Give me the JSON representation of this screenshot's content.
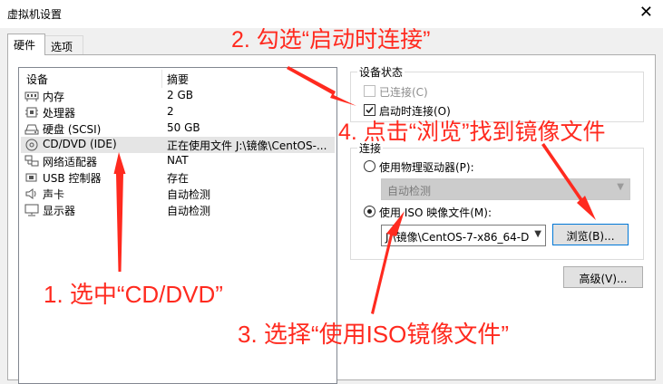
{
  "window": {
    "title": "虚拟机设置",
    "close_glyph": "✕"
  },
  "tabs": [
    {
      "label": "硬件",
      "active": true
    },
    {
      "label": "选项",
      "active": false
    }
  ],
  "device_list": {
    "headers": {
      "device": "设备",
      "summary": "摘要"
    },
    "rows": [
      {
        "icon": "memory-icon",
        "name": "内存",
        "summary": "2 GB"
      },
      {
        "icon": "cpu-icon",
        "name": "处理器",
        "summary": "2"
      },
      {
        "icon": "harddisk-icon",
        "name": "硬盘 (SCSI)",
        "summary": "50 GB"
      },
      {
        "icon": "cd-dvd-icon",
        "name": "CD/DVD (IDE)",
        "summary": "正在使用文件 J:\\镜像\\CentOS-...",
        "selected": true
      },
      {
        "icon": "network-icon",
        "name": "网络适配器",
        "summary": "NAT"
      },
      {
        "icon": "usb-icon",
        "name": "USB 控制器",
        "summary": "存在"
      },
      {
        "icon": "speaker-icon",
        "name": "声卡",
        "summary": "自动检测"
      },
      {
        "icon": "monitor-icon",
        "name": "显示器",
        "summary": "自动检测"
      }
    ]
  },
  "device_status": {
    "label": "设备状态",
    "connected": {
      "label": "已连接(C)",
      "checked": false,
      "disabled": true
    },
    "connect_at_power_on": {
      "label": "启动时连接(O)",
      "checked": true
    }
  },
  "connection": {
    "label": "连接",
    "physical_drive": {
      "label": "使用物理驱动器(P):",
      "selected": false
    },
    "drive_select": {
      "value": "自动检测"
    },
    "iso_image": {
      "label": "使用 ISO 映像文件(M):",
      "selected": true
    },
    "iso_path": {
      "value": "J:\\镜像\\CentOS-7-x86_64-D"
    },
    "browse_label": "浏览(B)..."
  },
  "advanced_label": "高级(V)...",
  "annotations": {
    "a1": "1. 选中“CD/DVD”",
    "a2": "2. 勾选“启动时连接”",
    "a3": "3. 选择“使用ISO镜像文件”",
    "a4": "4. 点击“浏览”找到镜像文件",
    "color": "#ff2a1f"
  }
}
